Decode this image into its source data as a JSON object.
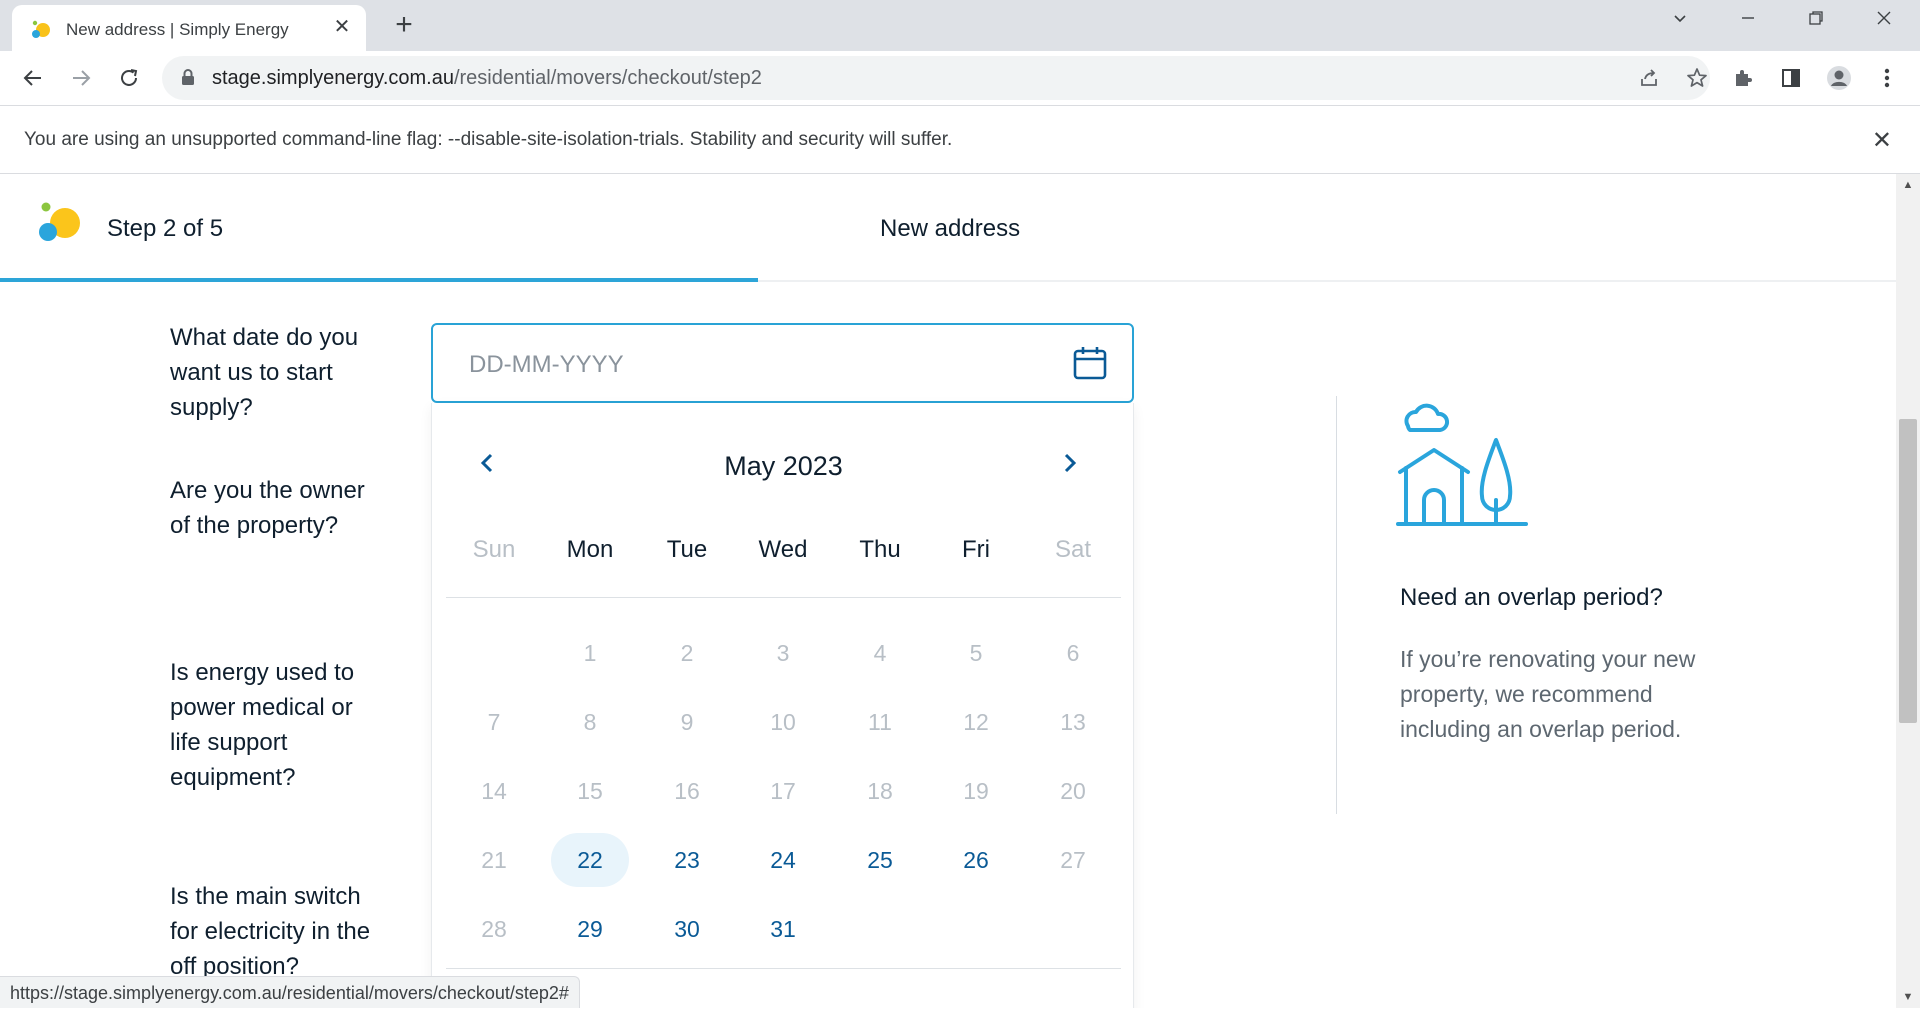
{
  "browser": {
    "tab_title": "New address | Simply Energy",
    "url_host": "stage.simplyenergy.com.au",
    "url_path": "/residential/movers/checkout/step2",
    "infobar_message": "You are using an unsupported command-line flag: --disable-site-isolation-trials. Stability and security will suffer.",
    "status_url": "https://stage.simplyenergy.com.au/residential/movers/checkout/step2#"
  },
  "header": {
    "step_label": "Step 2 of 5",
    "title": "New address",
    "progress_fraction": 0.4
  },
  "form": {
    "questions": [
      "What date do you want us to start supply?",
      "Are you the owner of the property?",
      "Is energy used to power medical or life support equipment?",
      "Is the main switch for electricity in the off position?"
    ],
    "date_placeholder": "DD-MM-YYYY"
  },
  "calendar": {
    "month_label": "May 2023",
    "weekdays": [
      "Sun",
      "Mon",
      "Tue",
      "Wed",
      "Thu",
      "Fri",
      "Sat"
    ],
    "first_day_offset": 1,
    "days_in_month": 31,
    "today": 22,
    "available_days": [
      22,
      23,
      24,
      25,
      26,
      29,
      30,
      31
    ]
  },
  "sidebar": {
    "title": "Need an overlap period?",
    "body": "If you’re renovating your new property, we recommend including an overlap period."
  },
  "colors": {
    "accent": "#29a3d6",
    "day_available": "#0a5a96",
    "day_disabled": "#b8bfc6"
  }
}
